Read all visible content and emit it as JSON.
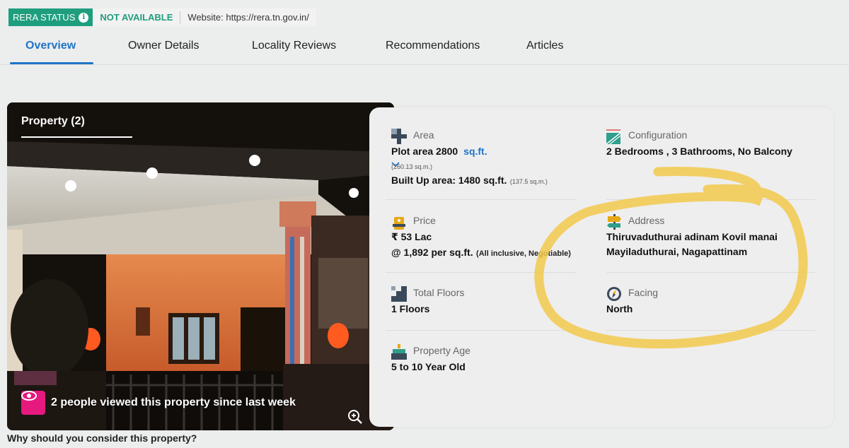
{
  "rera": {
    "badge_label": "RERA STATUS",
    "status": "NOT AVAILABLE",
    "website": "Website: https://rera.tn.gov.in/"
  },
  "tabs": [
    {
      "label": "Overview",
      "active": true
    },
    {
      "label": "Owner Details",
      "active": false
    },
    {
      "label": "Locality Reviews",
      "active": false
    },
    {
      "label": "Recommendations",
      "active": false
    },
    {
      "label": "Articles",
      "active": false
    }
  ],
  "photo": {
    "title": "Property (2)",
    "views_text": "2 people viewed this property since last week"
  },
  "details": {
    "area": {
      "label": "Area",
      "plot": "Plot area 2800",
      "unit": "sq.ft.",
      "plot_sqm": "(260.13 sq.m.)",
      "built_up": "Built Up area: 1480 sq.ft.",
      "built_up_sqm": "(137.5 sq.m.)"
    },
    "configuration": {
      "label": "Configuration",
      "value": "2 Bedrooms , 3 Bathrooms, No Balcony"
    },
    "price": {
      "label": "Price",
      "value": "₹ 53 Lac",
      "per_sqft": "@ 1,892 per sq.ft.",
      "note": "(All inclusive, Negotiable)"
    },
    "address": {
      "label": "Address",
      "line1": "Thiruvaduthurai adinam Kovil manai",
      "line2": "Mayiladuthurai, Nagapattinam"
    },
    "floors": {
      "label": "Total Floors",
      "value": "1 Floors"
    },
    "facing": {
      "label": "Facing",
      "value": "North"
    },
    "age": {
      "label": "Property Age",
      "value": "5 to 10 Year Old"
    }
  },
  "footer": {
    "question": "Why should you consider this property?"
  },
  "colors": {
    "accent_blue": "#1e74c6",
    "rera_green": "#1f9e7e",
    "views_pink": "#e5197e",
    "highlight_yellow": "#f2c94c"
  }
}
